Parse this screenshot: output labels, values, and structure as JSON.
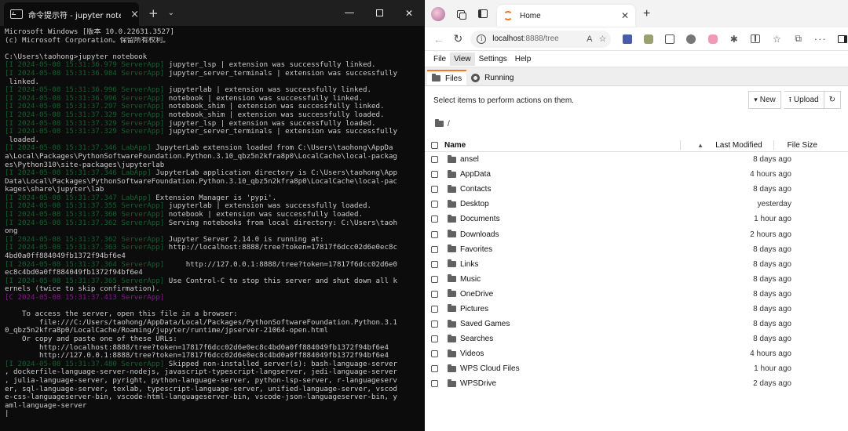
{
  "terminal": {
    "tab_title": "命令提示符 - jupyter noteboc",
    "new_tab": "+",
    "dropdown": "⌄",
    "close_tab": "×",
    "lines": [
      {
        "text": "Microsoft Windows [版本 10.0.22631.3527]"
      },
      {
        "text": "(c) Microsoft Corporation。保留所有权利。"
      },
      {
        "text": ""
      },
      {
        "text": "C:\\Users\\taohong>jupyter notebook"
      },
      {
        "ts": "[I 2024-05-08 15:31:36.979 ServerApp]",
        "text": " jupyter_lsp | extension was successfully linked."
      },
      {
        "ts": "[I 2024-05-08 15:31:36.984 ServerApp]",
        "text": " jupyter_server_terminals | extension was successfully"
      },
      {
        "text": " linked."
      },
      {
        "ts": "[I 2024-05-08 15:31:36.996 ServerApp]",
        "text": " jupyterlab | extension was successfully linked."
      },
      {
        "ts": "[I 2024-05-08 15:31:36.996 ServerApp]",
        "text": " notebook | extension was successfully linked."
      },
      {
        "ts": "[I 2024-05-08 15:31:37.297 ServerApp]",
        "text": " notebook_shim | extension was successfully linked."
      },
      {
        "ts": "[I 2024-05-08 15:31:37.329 ServerApp]",
        "text": " notebook_shim | extension was successfully loaded."
      },
      {
        "ts": "[I 2024-05-08 15:31:37.329 ServerApp]",
        "text": " jupyter_lsp | extension was successfully loaded."
      },
      {
        "ts": "[I 2024-05-08 15:31:37.329 ServerApp]",
        "text": " jupyter_server_terminals | extension was successfully"
      },
      {
        "text": " loaded."
      },
      {
        "ts": "[I 2024-05-08 15:31:37.346 LabApp]",
        "text": " JupyterLab extension loaded from C:\\Users\\taohong\\AppDa"
      },
      {
        "text": "a\\Local\\Packages\\PythonSoftwareFoundation.Python.3.10_qbz5n2kfra8p0\\LocalCache\\local-packag"
      },
      {
        "text": "es\\Python310\\site-packages\\jupyterlab"
      },
      {
        "ts": "[I 2024-05-08 15:31:37.346 LabApp]",
        "text": " JupyterLab application directory is C:\\Users\\taohong\\App"
      },
      {
        "text": "Data\\Local\\Packages\\PythonSoftwareFoundation.Python.3.10_qbz5n2kfra8p0\\LocalCache\\local-pac"
      },
      {
        "text": "kages\\share\\jupyter\\lab"
      },
      {
        "ts": "[I 2024-05-08 15:31:37.347 LabApp]",
        "text": " Extension Manager is 'pypi'."
      },
      {
        "ts": "[I 2024-05-08 15:31:37.355 ServerApp]",
        "text": " jupyterlab | extension was successfully loaded."
      },
      {
        "ts": "[I 2024-05-08 15:31:37.360 ServerApp]",
        "text": " notebook | extension was successfully loaded."
      },
      {
        "ts": "[I 2024-05-08 15:31:37.362 ServerApp]",
        "text": " Serving notebooks from local directory: C:\\Users\\taoh"
      },
      {
        "text": "ong"
      },
      {
        "ts": "[I 2024-05-08 15:31:37.362 ServerApp]",
        "text": " Jupyter Server 2.14.0 is running at:"
      },
      {
        "ts": "[I 2024-05-08 15:31:37.363 ServerApp]",
        "text": " http://localhost:8888/tree?token=17817f6dcc02d6e0ec8c"
      },
      {
        "text": "4bd0a0ff884049fb1372f94bf6e4"
      },
      {
        "ts": "[I 2024-05-08 15:31:37.364 ServerApp]",
        "text": "     http://127.0.0.1:8888/tree?token=17817f6dcc02d6e0"
      },
      {
        "text": "ec8c4bd0a0ff884049fb1372f94bf6e4"
      },
      {
        "ts": "[I 2024-05-08 15:31:37.365 ServerApp]",
        "text": " Use Control-C to stop this server and shut down all k"
      },
      {
        "text": "ernels (twice to skip confirmation)."
      },
      {
        "tsc": "[C 2024-05-08 15:31:37.413 ServerApp]",
        "text": ""
      },
      {
        "text": ""
      },
      {
        "text": "    To access the server, open this file in a browser:"
      },
      {
        "text": "        file:///C:/Users/taohong/AppData/Local/Packages/PythonSoftwareFoundation.Python.3.1"
      },
      {
        "text": "0_qbz5n2kfra8p0/LocalCache/Roaming/jupyter/runtime/jpserver-21064-open.html"
      },
      {
        "text": "    Or copy and paste one of these URLs:"
      },
      {
        "text": "        http://localhost:8888/tree?token=17817f6dcc02d6e0ec8c4bd0a0ff884049fb1372f94bf6e4"
      },
      {
        "text": "        http://127.0.0.1:8888/tree?token=17817f6dcc02d6e0ec8c4bd0a0ff884049fb1372f94bf6e4"
      },
      {
        "ts": "[I 2024-05-08 15:31:37.480 ServerApp]",
        "text": " Skipped non-installed server(s): bash-language-server"
      },
      {
        "text": ", dockerfile-language-server-nodejs, javascript-typescript-langserver, jedi-language-server"
      },
      {
        "text": ", julia-language-server, pyright, python-language-server, python-lsp-server, r-languageserv"
      },
      {
        "text": "er, sql-language-server, texlab, typescript-language-server, unified-language-server, vscod"
      },
      {
        "text": "e-css-languageserver-bin, vscode-html-languageserver-bin, vscode-json-languageserver-bin, y"
      },
      {
        "text": "aml-language-server"
      },
      {
        "text": "|"
      }
    ]
  },
  "browser": {
    "tab_title": "Home",
    "url_host": "localhost",
    "url_rest": ":8888/tree",
    "menu": [
      "File",
      "View",
      "Settings",
      "Help"
    ],
    "active_menu": 1,
    "tabs": [
      "Files",
      "Running"
    ],
    "toolbar_hint": "Select items to perform actions on them.",
    "new_label": "New",
    "upload_label": "Upload",
    "crumb": "/",
    "columns": {
      "name": "Name",
      "modified": "Last Modified",
      "size": "File Size"
    },
    "files": [
      {
        "name": "ansel",
        "modified": "8 days ago"
      },
      {
        "name": "AppData",
        "modified": "4 hours ago"
      },
      {
        "name": "Contacts",
        "modified": "8 days ago"
      },
      {
        "name": "Desktop",
        "modified": "yesterday"
      },
      {
        "name": "Documents",
        "modified": "1 hour ago"
      },
      {
        "name": "Downloads",
        "modified": "2 hours ago"
      },
      {
        "name": "Favorites",
        "modified": "8 days ago"
      },
      {
        "name": "Links",
        "modified": "8 days ago"
      },
      {
        "name": "Music",
        "modified": "8 days ago"
      },
      {
        "name": "OneDrive",
        "modified": "8 days ago"
      },
      {
        "name": "Pictures",
        "modified": "8 days ago"
      },
      {
        "name": "Saved Games",
        "modified": "8 days ago"
      },
      {
        "name": "Searches",
        "modified": "8 days ago"
      },
      {
        "name": "Videos",
        "modified": "4 hours ago"
      },
      {
        "name": "WPS Cloud Files",
        "modified": "1 hour ago"
      },
      {
        "name": "WPSDrive",
        "modified": "2 days ago"
      }
    ]
  },
  "colors": {
    "jupyter_accent": "#f37626",
    "terminal_bg": "#0c0c0c",
    "log_prefix": "#16a34a"
  }
}
